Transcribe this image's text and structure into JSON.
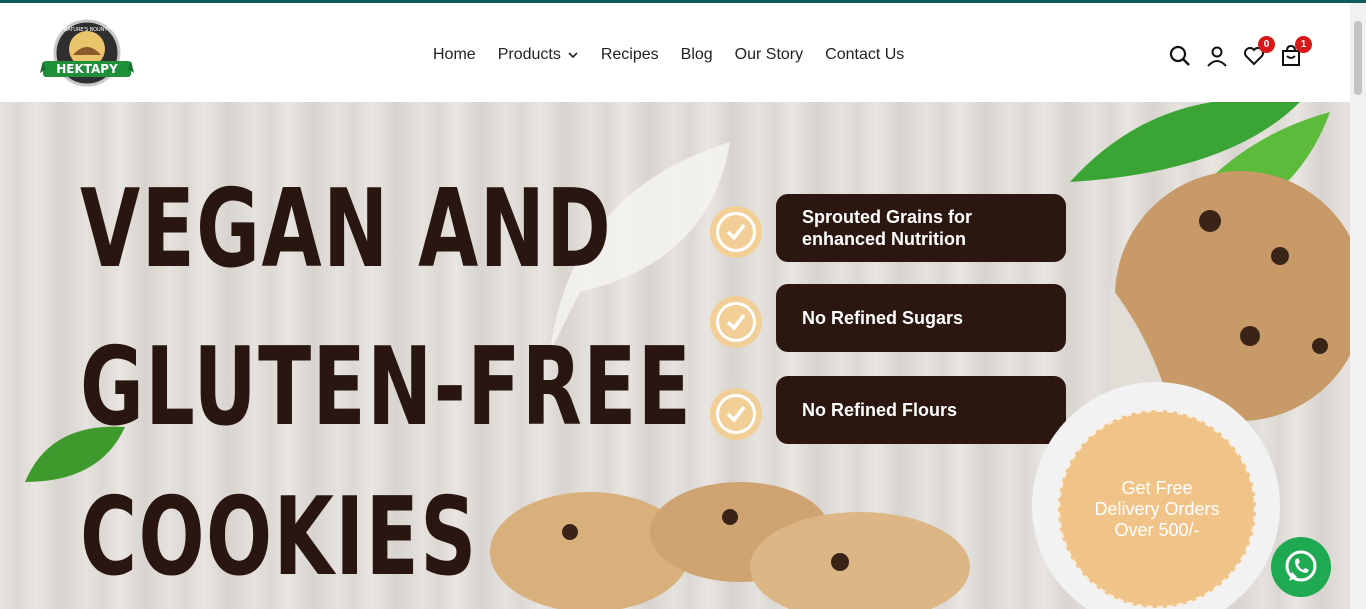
{
  "header": {
    "logo_text": "HEKTAPY",
    "logo_sub": "NATURE'S BOUNTY",
    "nav": [
      {
        "label": "Home"
      },
      {
        "label": "Products"
      },
      {
        "label": "Recipes"
      },
      {
        "label": "Blog"
      },
      {
        "label": "Our Story"
      },
      {
        "label": "Contact Us"
      }
    ],
    "wishlist_count": "0",
    "cart_count": "1"
  },
  "hero": {
    "headline": [
      "VEGAN AND",
      "GLUTEN-FREE",
      "COOKIES"
    ],
    "features": [
      {
        "line1": "Sprouted Grains for",
        "line2": "enhanced Nutrition"
      },
      {
        "line1": "No Refined Sugars",
        "line2": ""
      },
      {
        "line1": "No Refined Flours",
        "line2": ""
      }
    ],
    "delivery_text": [
      "Get Free",
      "Delivery Orders",
      "Over 500/-"
    ]
  },
  "colors": {
    "brand_dark": "#2b170f",
    "accent_peach": "#f3cf98",
    "topbar": "#0e5a5c",
    "badge": "#d81818",
    "whatsapp": "#1ea952"
  },
  "icons": [
    "search-icon",
    "user-icon",
    "heart-icon",
    "cart-icon",
    "whatsapp-icon",
    "check-icon",
    "chevron-down-icon"
  ]
}
